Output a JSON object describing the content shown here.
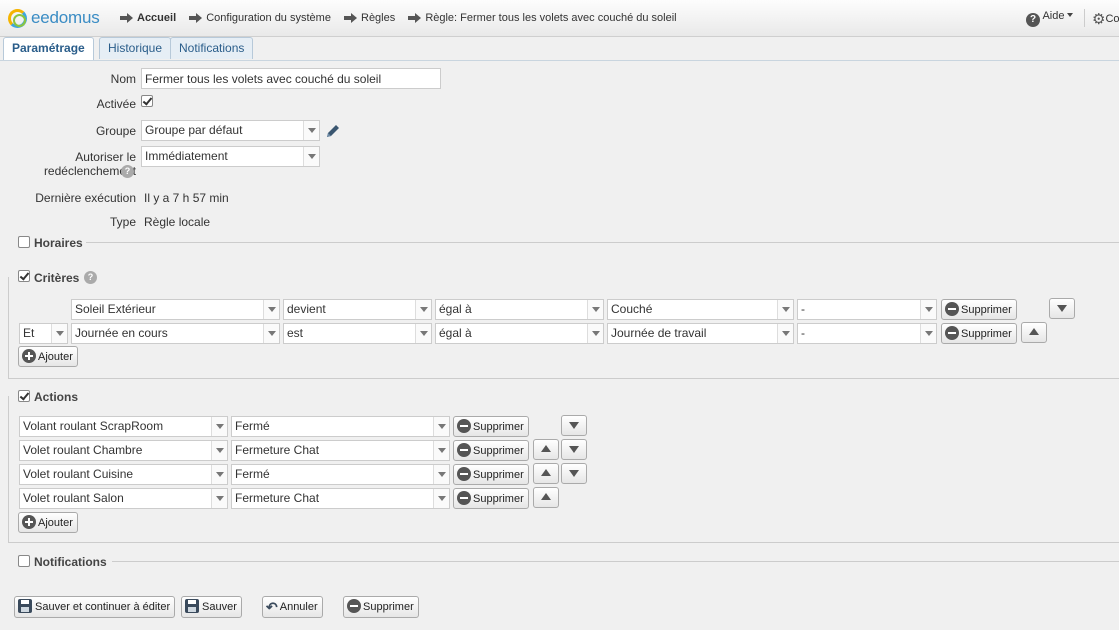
{
  "header": {
    "logo_text": "eedomus",
    "breadcrumbs": [
      {
        "label": "Accueil"
      },
      {
        "label": "Configuration du système"
      },
      {
        "label": "Règles"
      },
      {
        "label": "Règle: Fermer tous les volets avec couché du soleil"
      }
    ],
    "help_label": "Aide",
    "config_label": "Co"
  },
  "tabs": [
    {
      "label": "Paramétrage",
      "active": true
    },
    {
      "label": "Historique"
    },
    {
      "label": "Notifications"
    }
  ],
  "form": {
    "nom_label": "Nom",
    "nom_value": "Fermer tous les volets avec couché du soleil",
    "activee_label": "Activée",
    "groupe_label": "Groupe",
    "groupe_value": "Groupe par défaut",
    "redecl_label_line1": "Autoriser le",
    "redecl_label_line2": "redéclenchement",
    "redecl_value": "Immédiatement",
    "last_exec_label": "Dernière exécution",
    "last_exec_value": "Il y a 7 h 57 min",
    "type_label": "Type",
    "type_value": "Règle locale"
  },
  "sections": {
    "horaires": "Horaires",
    "criteres": "Critères",
    "actions": "Actions",
    "notifications": "Notifications"
  },
  "criteria": [
    {
      "conj": "",
      "device": "Soleil Extérieur",
      "verb": "devient",
      "op": "égal à",
      "value": "Couché",
      "extra": "-"
    },
    {
      "conj": "Et",
      "device": "Journée en cours",
      "verb": "est",
      "op": "égal à",
      "value": "Journée de travail",
      "extra": "-"
    }
  ],
  "actions": [
    {
      "device": "Volant roulant ScrapRoom",
      "value": "Fermé"
    },
    {
      "device": "Volet roulant Chambre",
      "value": "Fermeture Chat"
    },
    {
      "device": "Volet roulant Cuisine",
      "value": "Fermé"
    },
    {
      "device": "Volet roulant Salon",
      "value": "Fermeture Chat"
    }
  ],
  "buttons": {
    "supprimer": "Supprimer",
    "ajouter": "Ajouter",
    "save_continue": "Sauver et continuer à éditer",
    "save": "Sauver",
    "cancel": "Annuler",
    "delete": "Supprimer"
  }
}
